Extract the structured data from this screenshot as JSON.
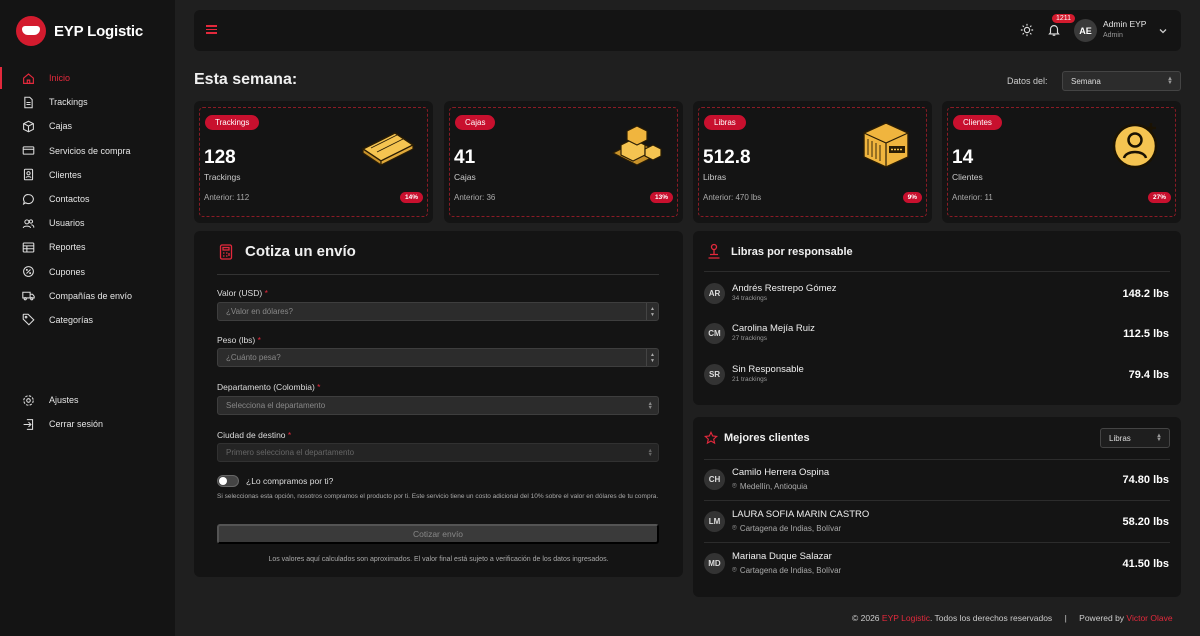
{
  "brand": {
    "name": "EYP Logistic"
  },
  "sidebar": {
    "items": [
      {
        "label": "Inicio",
        "icon": "home-icon",
        "active": true
      },
      {
        "label": "Trackings",
        "icon": "document-icon"
      },
      {
        "label": "Cajas",
        "icon": "box-icon"
      },
      {
        "label": "Servicios de compra",
        "icon": "credit-card-icon"
      },
      {
        "label": "Clientes",
        "icon": "id-card-icon"
      },
      {
        "label": "Contactos",
        "icon": "chat-icon"
      },
      {
        "label": "Usuarios",
        "icon": "users-icon"
      },
      {
        "label": "Reportes",
        "icon": "table-icon"
      },
      {
        "label": "Cupones",
        "icon": "ticket-icon"
      },
      {
        "label": "Compañías de envío",
        "icon": "truck-icon"
      },
      {
        "label": "Categorías",
        "icon": "tag-icon"
      }
    ],
    "bottom": [
      {
        "label": "Ajustes",
        "icon": "gear-icon"
      },
      {
        "label": "Cerrar sesión",
        "icon": "logout-icon"
      }
    ]
  },
  "topbar": {
    "notifications": "1211",
    "avatar_initials": "AE",
    "user_name": "Admin EYP",
    "user_role": "Admin"
  },
  "dashboard": {
    "title": "Esta semana:",
    "period_label": "Datos del:",
    "period_value": "Semana"
  },
  "stats": [
    {
      "pill": "Trackings",
      "value": "128",
      "label": "Trackings",
      "previous": "Anterior: 112",
      "change": "14%"
    },
    {
      "pill": "Cajas",
      "value": "41",
      "label": "Cajas",
      "previous": "Anterior: 36",
      "change": "13%"
    },
    {
      "pill": "Libras",
      "value": "512.8",
      "label": "Libras",
      "previous": "Anterior: 470 lbs",
      "change": "9%"
    },
    {
      "pill": "Clientes",
      "value": "14",
      "label": "Clientes",
      "previous": "Anterior: 11",
      "change": "27%"
    }
  ],
  "quote": {
    "title": "Cotiza un envío",
    "fields": [
      {
        "label": "Valor (USD)",
        "placeholder": "¿Valor en dólares?"
      },
      {
        "label": "Peso (lbs)",
        "placeholder": "¿Cuánto pesa?"
      },
      {
        "label": "Departamento (Colombia)",
        "placeholder": "Selecciona el departamento"
      },
      {
        "label": "Ciudad de destino",
        "placeholder": "Primero selecciona el departamento"
      }
    ],
    "required_mark": "*",
    "toggle_label": "¿Lo compramos por ti?",
    "helper": "Si seleccionas esta opción, nosotros compramos el producto por ti. Este servicio tiene un costo adicional del 10% sobre el valor en dólares de tu compra.",
    "submit": "Cotizar envío",
    "disclaimer": "Los valores aquí calculados son aproximados. El valor final está sujeto a verificación de los datos ingresados."
  },
  "responsables": {
    "title": "Libras por responsable",
    "rows": [
      {
        "initials": "AR",
        "name": "Andrés Restrepo Gómez",
        "sub": "34 trackings",
        "value": "148.2 lbs"
      },
      {
        "initials": "CM",
        "name": "Carolina Mejía Ruiz",
        "sub": "27 trackings",
        "value": "112.5 lbs"
      },
      {
        "initials": "SR",
        "name": "Sin Responsable",
        "sub": "21 trackings",
        "value": "79.4 lbs"
      }
    ]
  },
  "clientes": {
    "title": "Mejores clientes",
    "filter": "Libras",
    "rows": [
      {
        "initials": "CH",
        "name": "Camilo Herrera Ospina",
        "location": "Medellín, Antioquia",
        "value": "74.80 lbs"
      },
      {
        "initials": "LM",
        "name": "LAURA SOFIA MARIN CASTRO",
        "location": "Cartagena de Indias, Bolívar",
        "value": "58.20 lbs"
      },
      {
        "initials": "MD",
        "name": "Mariana Duque Salazar",
        "location": "Cartagena de Indias, Bolívar",
        "value": "41.50 lbs"
      }
    ]
  },
  "footer": {
    "copyright": "© 2026",
    "brand": "EYP Logistic",
    "rights": ". Todos los derechos reservados",
    "separator": "|",
    "powered": "Powered by",
    "author": "Victor Olave"
  }
}
